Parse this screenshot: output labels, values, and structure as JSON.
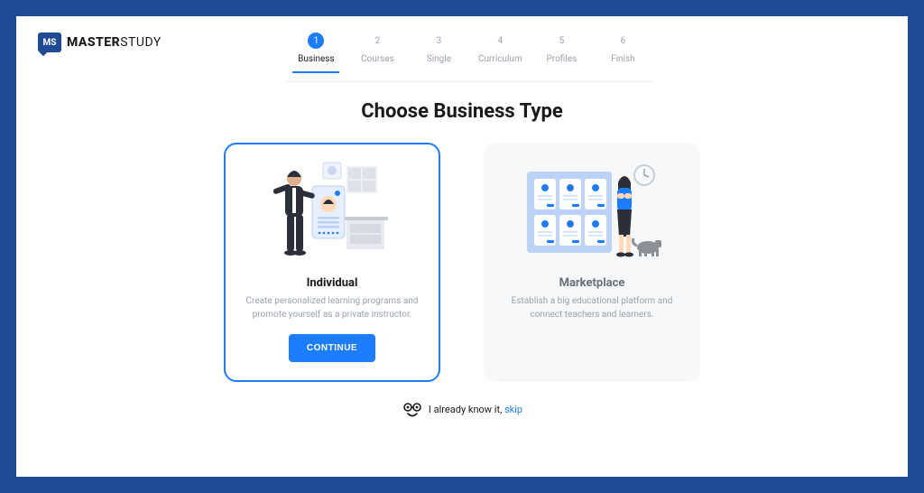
{
  "brand": {
    "mark": "MS",
    "name_bold": "MASTER",
    "name_rest": "STUDY"
  },
  "steps": [
    {
      "num": "1",
      "label": "Business",
      "active": true
    },
    {
      "num": "2",
      "label": "Courses",
      "active": false
    },
    {
      "num": "3",
      "label": "Single",
      "active": false
    },
    {
      "num": "4",
      "label": "Curriculum",
      "active": false
    },
    {
      "num": "5",
      "label": "Profiles",
      "active": false
    },
    {
      "num": "6",
      "label": "Finish",
      "active": false
    }
  ],
  "page_title": "Choose Business Type",
  "cards": {
    "individual": {
      "title": "Individual",
      "desc": "Create personalized learning programs and promote yourself as a private instructor.",
      "cta": "CONTINUE"
    },
    "marketplace": {
      "title": "Marketplace",
      "desc": "Establish a big educational platform and connect teachers and learners."
    }
  },
  "skip": {
    "lead": "I already know it, ",
    "link": "skip"
  }
}
